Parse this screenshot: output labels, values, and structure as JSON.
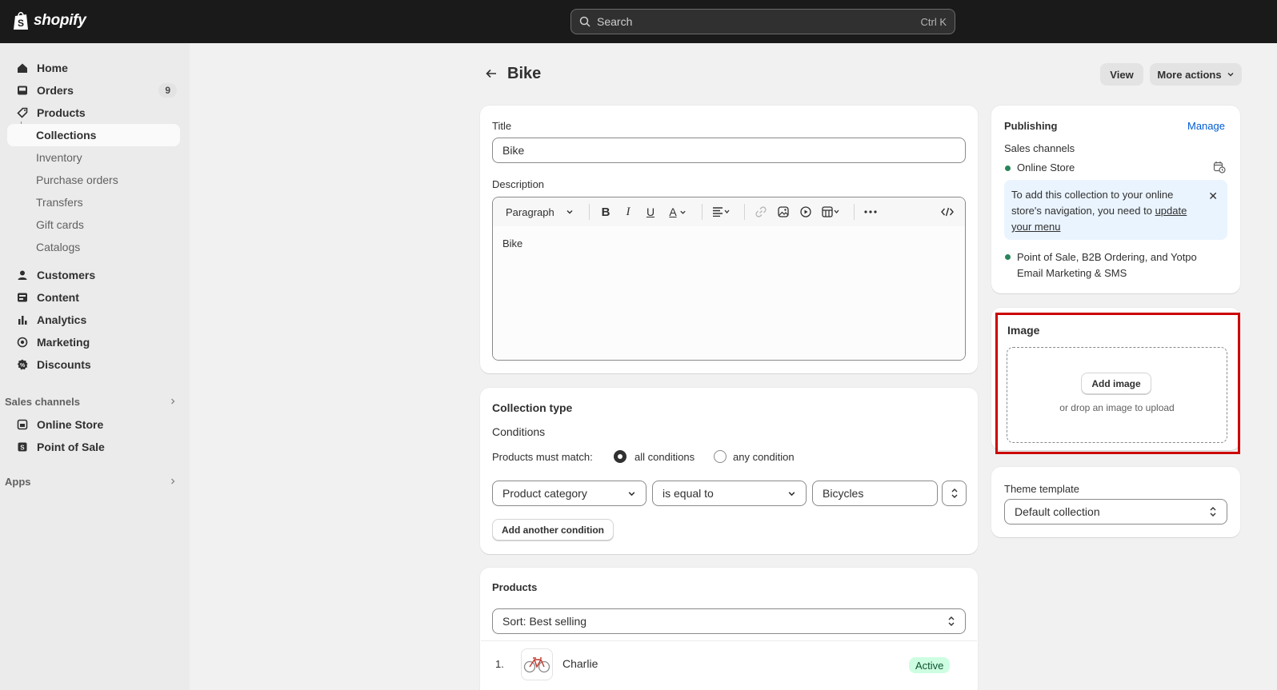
{
  "topbar": {
    "brand": "shopify",
    "search_placeholder": "Search",
    "search_shortcut": "Ctrl K"
  },
  "sidebar": {
    "items": [
      {
        "label": "Home",
        "icon": "home-icon"
      },
      {
        "label": "Orders",
        "icon": "inbox-icon",
        "badge": "9"
      },
      {
        "label": "Products",
        "icon": "tag-icon"
      },
      {
        "label": "Collections"
      },
      {
        "label": "Inventory"
      },
      {
        "label": "Purchase orders"
      },
      {
        "label": "Transfers"
      },
      {
        "label": "Gift cards"
      },
      {
        "label": "Catalogs"
      },
      {
        "label": "Customers",
        "icon": "person-icon"
      },
      {
        "label": "Content",
        "icon": "content-icon"
      },
      {
        "label": "Analytics",
        "icon": "bar-chart-icon"
      },
      {
        "label": "Marketing",
        "icon": "target-icon"
      },
      {
        "label": "Discounts",
        "icon": "discount-icon"
      }
    ],
    "sales_channels_heading": "Sales channels",
    "channels": [
      {
        "label": "Online Store",
        "icon": "store-icon"
      },
      {
        "label": "Point of Sale",
        "icon": "pos-icon"
      }
    ],
    "apps_heading": "Apps"
  },
  "page": {
    "title": "Bike",
    "view_button": "View",
    "more_actions_button": "More actions"
  },
  "details": {
    "title_label": "Title",
    "title_value": "Bike",
    "description_label": "Description",
    "toolbar_paragraph": "Paragraph",
    "description_value": "Bike"
  },
  "collection_type": {
    "heading": "Collection type",
    "conditions_label": "Conditions",
    "match_label": "Products must match:",
    "option_all": "all conditions",
    "option_any": "any condition",
    "selected": "all conditions",
    "condition_field": "Product category",
    "condition_operator": "is equal to",
    "condition_value": "Bicycles",
    "add_condition_button": "Add another condition"
  },
  "products": {
    "heading": "Products",
    "sort_label": "Sort: Best selling",
    "rows": [
      {
        "index": "1.",
        "name": "Charlie",
        "status": "Active"
      }
    ]
  },
  "publishing": {
    "heading": "Publishing",
    "manage_link": "Manage",
    "sales_channels_label": "Sales channels",
    "channel_1": "Online Store",
    "banner_text": "To add this collection to your online store's navigation, you need to",
    "banner_link": "update your menu",
    "channel_2": "Point of Sale, B2B Ordering, and Yotpo Email Marketing & SMS"
  },
  "image": {
    "heading": "Image",
    "add_button": "Add image",
    "drop_hint": "or drop an image to upload"
  },
  "theme": {
    "label": "Theme template",
    "value": "Default collection"
  },
  "colors": {
    "topbar": "#1a1a1a",
    "active_status_bg": "#cdfee1",
    "highlight_border": "#cc0000",
    "link": "#005bd3"
  }
}
